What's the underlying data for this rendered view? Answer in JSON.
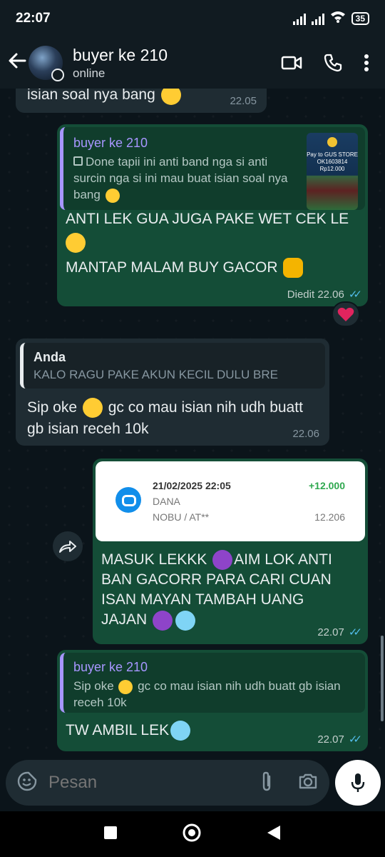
{
  "status_bar": {
    "time": "22:07",
    "battery": "35"
  },
  "header": {
    "contact_name": "buyer ke 210",
    "presence": "online"
  },
  "messages": {
    "m1": {
      "text": "isian soal nya bang",
      "time": "22.05"
    },
    "m2": {
      "quote_name": "buyer ke 210",
      "quote_text": "Done tapii ini anti band nga si anti surcin nga si ini mau buat isian soal nya bang",
      "thumb_line1": "Pay to GUS STORE",
      "thumb_line2": "OK1603814",
      "thumb_line3": "Rp12.000",
      "line1": "ANTI LEK GUA JUGA PAKE WET CEK LE",
      "line2": "MANTAP MALAM BUY GACOR",
      "meta": "Diedit 22.06",
      "reaction": "heart"
    },
    "m3": {
      "quote_name": "Anda",
      "quote_text": "KALO RAGU PAKE AKUN KECIL DULU BRE",
      "text_a": "Sip oke",
      "text_b": "gc co mau isian nih udh buatt gb isian receh 10k",
      "time": "22.06"
    },
    "m4": {
      "receipt_date": "21/02/2025 22:05",
      "receipt_bank": "DANA",
      "receipt_account": "NOBU / AT**",
      "receipt_amount": "+12.000",
      "receipt_balance": "12.206",
      "line1a": "MASUK LEKKK",
      "line1b": "AIM LOK ANTI",
      "line2": "BAN GACORR PARA CARI CUAN",
      "line3": "ISAN MAYAN TAMBAH UANG",
      "line4": "JAJAN",
      "time": "22.07"
    },
    "m5": {
      "quote_name": "buyer ke 210",
      "quote_text_a": "Sip oke",
      "quote_text_b": "gc co mau isian nih udh buatt gb isian receh 10k",
      "text": "TW AMBIL LEK",
      "time": "22.07"
    }
  },
  "composer": {
    "placeholder": "Pesan"
  },
  "colors": {
    "background": "#0b141a",
    "bar": "#111b21",
    "incoming": "#1f2c33",
    "outgoing": "#144d37",
    "read_ticks": "#53bdeb",
    "quote_accent": "#a796ff",
    "reaction_heart": "#e0245e"
  },
  "icons": [
    "back-arrow-icon",
    "video-call-icon",
    "phone-icon",
    "more-vert-icon",
    "forward-icon",
    "sticker-icon",
    "attach-icon",
    "camera-icon",
    "mic-icon",
    "nav-square-icon",
    "nav-home-icon",
    "nav-back-icon"
  ]
}
